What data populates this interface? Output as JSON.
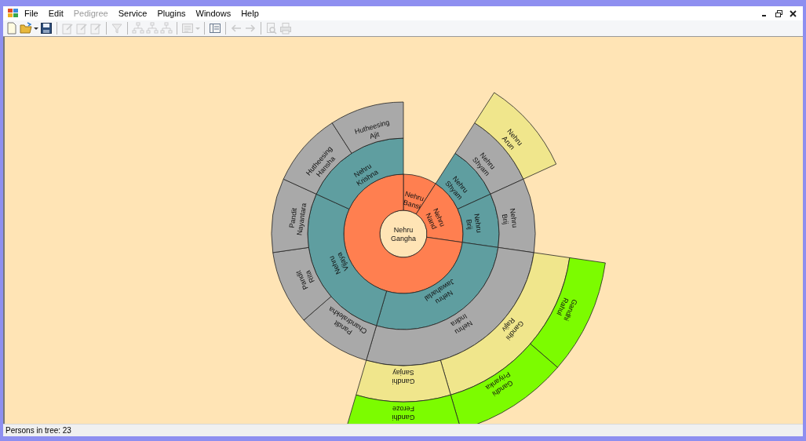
{
  "menu": [
    {
      "label": "File",
      "disabled": false
    },
    {
      "label": "Edit",
      "disabled": false
    },
    {
      "label": "Pedigree",
      "disabled": true
    },
    {
      "label": "Service",
      "disabled": false
    },
    {
      "label": "Plugins",
      "disabled": false
    },
    {
      "label": "Windows",
      "disabled": false
    },
    {
      "label": "Help",
      "disabled": false
    }
  ],
  "toolbar": [
    {
      "kind": "new",
      "disabled": false
    },
    {
      "kind": "open",
      "disabled": false
    },
    {
      "kind": "dropdown",
      "disabled": false
    },
    {
      "kind": "save",
      "disabled": false
    },
    {
      "kind": "sep"
    },
    {
      "kind": "record-add",
      "disabled": true
    },
    {
      "kind": "record-edit",
      "disabled": true
    },
    {
      "kind": "record-delete",
      "disabled": true
    },
    {
      "kind": "sep"
    },
    {
      "kind": "filter",
      "disabled": true
    },
    {
      "kind": "sep"
    },
    {
      "kind": "tree",
      "disabled": true
    },
    {
      "kind": "tree",
      "disabled": true
    },
    {
      "kind": "tree",
      "disabled": true
    },
    {
      "kind": "sep"
    },
    {
      "kind": "report",
      "disabled": true
    },
    {
      "kind": "dropdown",
      "disabled": true
    },
    {
      "kind": "sep"
    },
    {
      "kind": "panel",
      "disabled": false
    },
    {
      "kind": "sep"
    },
    {
      "kind": "back",
      "disabled": true
    },
    {
      "kind": "forward",
      "disabled": true
    },
    {
      "kind": "sep"
    },
    {
      "kind": "preview",
      "disabled": true
    },
    {
      "kind": "print",
      "disabled": true
    }
  ],
  "chart": {
    "root": {
      "surname": "Nehru",
      "given": "Gangha",
      "children": [
        {
          "surname": "Nehru",
          "given": "Bansi"
        },
        {
          "surname": "Nehru",
          "given": "Nand",
          "children": [
            {
              "surname": "Nehru",
              "given": "Shyam",
              "children": [
                {
                  "surname": "Nehru",
                  "given": "Shyam",
                  "children": [
                    {
                      "surname": "Nehru",
                      "given": "Arun"
                    }
                  ]
                }
              ]
            },
            {
              "surname": "Nehru",
              "given": "Brij",
              "children": [
                {
                  "surname": "Nehru",
                  "given": "Brij"
                }
              ]
            }
          ]
        },
        {
          "children": [
            {
              "surname": "Nehru",
              "given": "Jawaharlal",
              "children": [
                {
                  "surname": "Nehru",
                  "given": "Indira",
                  "children": [
                    {
                      "surname": "Gandhi",
                      "given": "Rajiv",
                      "children": [
                        {
                          "surname": "Gandhi",
                          "given": "Rahul"
                        },
                        {
                          "surname": "Gandhi",
                          "given": "Priyanka"
                        }
                      ]
                    },
                    {
                      "surname": "Gandhi",
                      "given": "Sanjay",
                      "children": [
                        {
                          "surname": "Gandhi",
                          "given": "Feroze"
                        }
                      ]
                    }
                  ]
                }
              ]
            },
            {
              "surname": "Nehru",
              "given": "Vijaya",
              "children": [
                {
                  "surname": "Pandit",
                  "given": "Chandralekha"
                },
                {
                  "surname": "Pandit",
                  "given": "Rita"
                },
                {
                  "surname": "Pandit",
                  "given": "Nayantara"
                }
              ]
            },
            {
              "surname": "Nehru",
              "given": "Krishna",
              "children": [
                {
                  "surname": "Hutheesing",
                  "given": "Hansha"
                },
                {
                  "surname": "Hutheesing",
                  "given": "Ajit"
                }
              ]
            }
          ]
        }
      ]
    }
  },
  "status_bar": "Persons in tree: 23"
}
